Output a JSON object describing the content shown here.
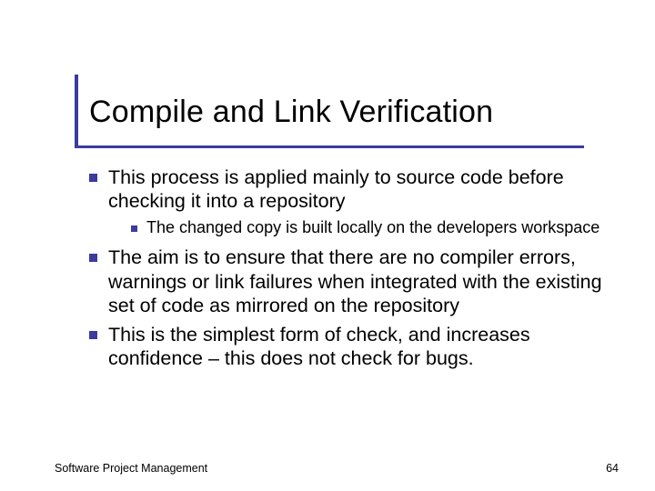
{
  "slide": {
    "title": "Compile and Link Verification",
    "bullets": {
      "b1": "This process is applied mainly to source code before checking it into a repository",
      "b1_sub1": "The changed copy is built locally on the developers workspace",
      "b2": "The aim is to ensure that there are no compiler errors, warnings or link failures when integrated with the existing set of code as mirrored on the repository",
      "b3": "This is the simplest form of check, and increases confidence – this does not check for bugs."
    },
    "footer": {
      "left": "Software Project Management",
      "page": "64"
    },
    "accent_color": "#3b3ba0"
  }
}
